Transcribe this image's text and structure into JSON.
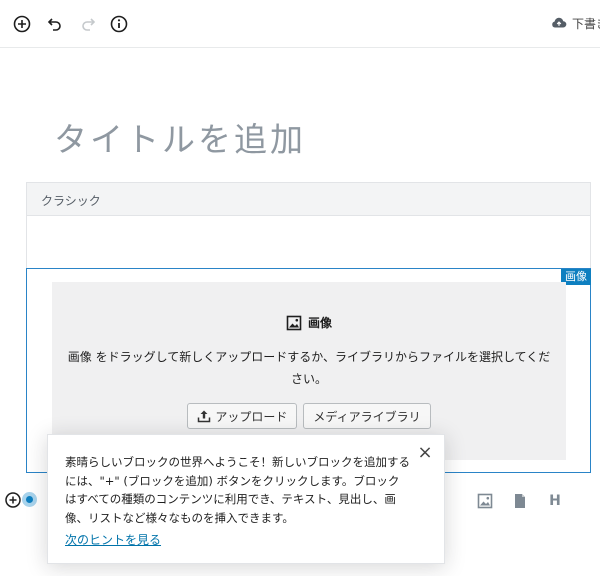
{
  "toolbar": {
    "add_block_icon": "plus-circle-icon",
    "undo_icon": "undo-icon",
    "redo_icon": "redo-icon",
    "info_icon": "info-icon",
    "save_draft_label": "下書き"
  },
  "editor": {
    "title_placeholder": "タイトルを追加"
  },
  "classic_block": {
    "label": "クラシック"
  },
  "image_block": {
    "tag": "画像",
    "title": "画像",
    "instructions": "画像 をドラッグして新しくアップロードするか、ライブラリからファイルを選択してください。",
    "upload_label": "アップロード",
    "media_library_label": "メディアライブラリ"
  },
  "tip": {
    "text": "素晴らしいブロックの世界へようこそ！新しいブロックを追加するには、\"+\" (ブロックを追加) ボタンをクリックします。ブロックはすべての種類のコンテンツに利用でき、テキスト、見出し、画像、リストなど様々なものを挿入できます。",
    "next_tip_label": "次のヒントを見る",
    "close_label": "×"
  },
  "quick_inserters": {
    "heading_label": "H"
  },
  "colors": {
    "accent": "#0e7fc0",
    "link": "#0073aa"
  }
}
